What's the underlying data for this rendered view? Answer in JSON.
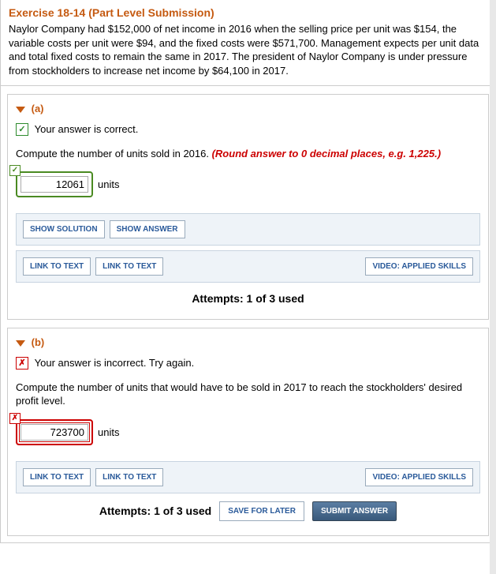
{
  "header": {
    "title": "Exercise 18-14 (Part Level Submission)",
    "prompt": "Naylor Company had $152,000 of net income in 2016 when the selling price per unit was $154, the variable costs per unit were $94, and the fixed costs were $571,700. Management expects per unit data and total fixed costs to remain the same in 2017. The president of Naylor Company is under pressure from stockholders to increase net income by $64,100 in 2017."
  },
  "part_a": {
    "label": "(a)",
    "status_mark": "✓",
    "status_text": "Your answer is correct.",
    "question": "Compute the number of units sold in 2016. ",
    "round_note": "(Round answer to 0 decimal places, e.g. 1,225.)",
    "answer_value": "12061",
    "units_label": "units",
    "buttons": {
      "show_solution": "SHOW SOLUTION",
      "show_answer": "SHOW ANSWER",
      "link1": "LINK TO TEXT",
      "link2": "LINK TO TEXT",
      "video": "VIDEO: APPLIED SKILLS"
    },
    "attempts": "Attempts: 1 of 3 used"
  },
  "part_b": {
    "label": "(b)",
    "status_mark": "✗",
    "status_text": "Your answer is incorrect.  Try again.",
    "question": "Compute the number of units that would have to be sold in 2017 to reach the stockholders' desired profit level.",
    "answer_value": "723700",
    "units_label": "units",
    "buttons": {
      "link1": "LINK TO TEXT",
      "link2": "LINK TO TEXT",
      "video": "VIDEO: APPLIED SKILLS"
    },
    "attempts": "Attempts: 1 of 3 used",
    "save": "SAVE FOR LATER",
    "submit": "SUBMIT ANSWER"
  }
}
